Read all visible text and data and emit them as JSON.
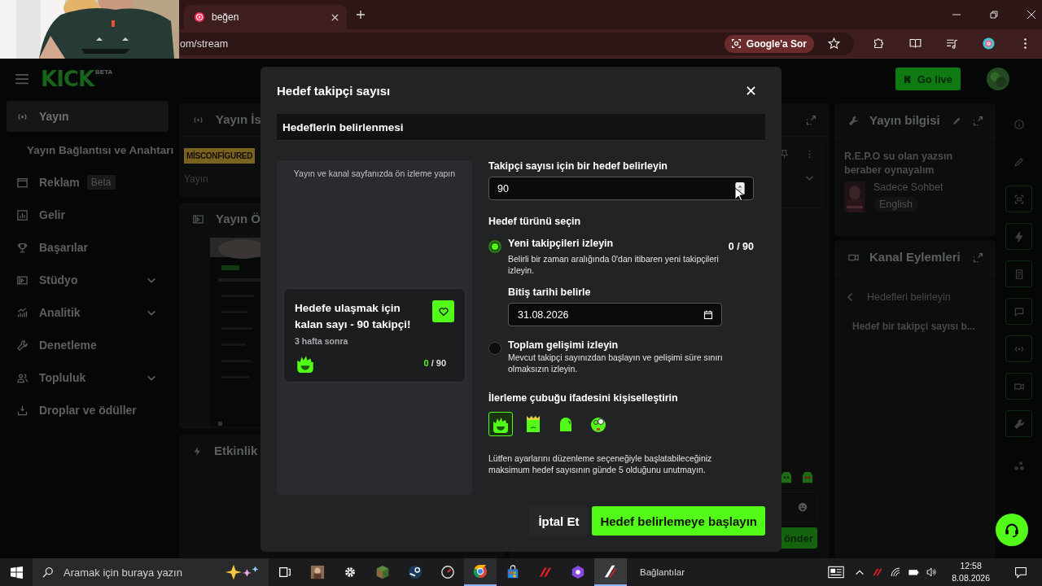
{
  "browser": {
    "tab": {
      "title": "beğen"
    },
    "address": "om/stream",
    "ask_button": "Google'a Sor"
  },
  "header": {
    "logo": "KICK",
    "logo_badge": "BETA",
    "go_live": "Go live"
  },
  "sidebar": {
    "items": [
      {
        "label": "Yayın",
        "kind": "item",
        "selected": true,
        "expandable": false
      },
      {
        "label": "Yayın Bağlantısı ve Anahtarı",
        "kind": "subitem",
        "selected": false,
        "expandable": false
      },
      {
        "label": "Reklam",
        "kind": "item",
        "badge": "Beta",
        "selected": false,
        "expandable": false
      },
      {
        "label": "Gelir",
        "kind": "item",
        "selected": false,
        "expandable": false
      },
      {
        "label": "Başarılar",
        "kind": "item",
        "selected": false,
        "expandable": false
      },
      {
        "label": "Stüdyo",
        "kind": "item",
        "selected": false,
        "expandable": true
      },
      {
        "label": "Analitik",
        "kind": "item",
        "selected": false,
        "expandable": true
      },
      {
        "label": "Denetleme",
        "kind": "item",
        "selected": false,
        "expandable": false
      },
      {
        "label": "Topluluk",
        "kind": "item",
        "selected": false,
        "expandable": true
      },
      {
        "label": "Droplar ve ödüller",
        "kind": "item",
        "selected": false,
        "expandable": false
      }
    ]
  },
  "stream_panel": {
    "title": "Yayın İs",
    "status": "MİSCONFİGURED",
    "label": "Yayın"
  },
  "preview_panel": {
    "title": "Yayın Ö"
  },
  "activity_panel": {
    "title": "Etkinlik"
  },
  "chat_panel": {
    "send_button": "önder"
  },
  "info_panel": {
    "title": "Yayın bilgisi",
    "stream_title": "R.E.P.O su olan yazsın beraber oynayalım",
    "category": "Sadece Sohbet",
    "language": "English"
  },
  "actions_panel": {
    "title": "Kanal Eylemleri",
    "back_label": "Hedefleri belirleyin",
    "item": "Hedef bir takipçi sayısı b..."
  },
  "modal": {
    "title": "Hedef takipçi sayısı",
    "section": "Hedeflerin belirlenmesi",
    "preview": {
      "caption": "Yayın ve kanal sayfanızda ön izleme yapın",
      "card_title": "Hedefe ulaşmak için kalan sayı - 90 takipçi!",
      "card_subtitle": "3 hafta sonra",
      "current": "0",
      "total": "/ 90"
    },
    "target_label": "Takipçi sayısı için bir hedef belirleyin",
    "target_value": "90",
    "type_label": "Hedef türünü seçin",
    "options": [
      {
        "title": "Yeni takipçileri izleyin",
        "description": "Belirli bir zaman aralığında 0'dan itibaren yeni takipçileri izleyin.",
        "selected": true,
        "count": "0 / 90",
        "date_label": "Bitiş tarihi belirle",
        "date": "31.08.2026"
      },
      {
        "title": "Toplam gelişimi izleyin",
        "description": "Mevcut takipçi sayınızdan başlayın ve gelişimi süre sınırı olmaksızın izleyin.",
        "selected": false
      }
    ],
    "emoji_label": "İlerleme çubuğu ifadesini kişiselleştirin",
    "emojis": [
      {
        "selected": true
      },
      {
        "selected": false
      },
      {
        "selected": false
      },
      {
        "selected": false
      }
    ],
    "note": "Lütfen ayarlarını düzenleme seçeneğiyle başlatabileceğiniz maksimum hedef sayısının günde 5 olduğunu unutmayın.",
    "cancel": "İptal Et",
    "submit": "Hedef belirlemeye başlayın"
  },
  "taskbar": {
    "search_placeholder": "Aramak için buraya yazın",
    "links_label": "Bağlantılar",
    "time": "12:58",
    "date": "8.08.2026"
  }
}
